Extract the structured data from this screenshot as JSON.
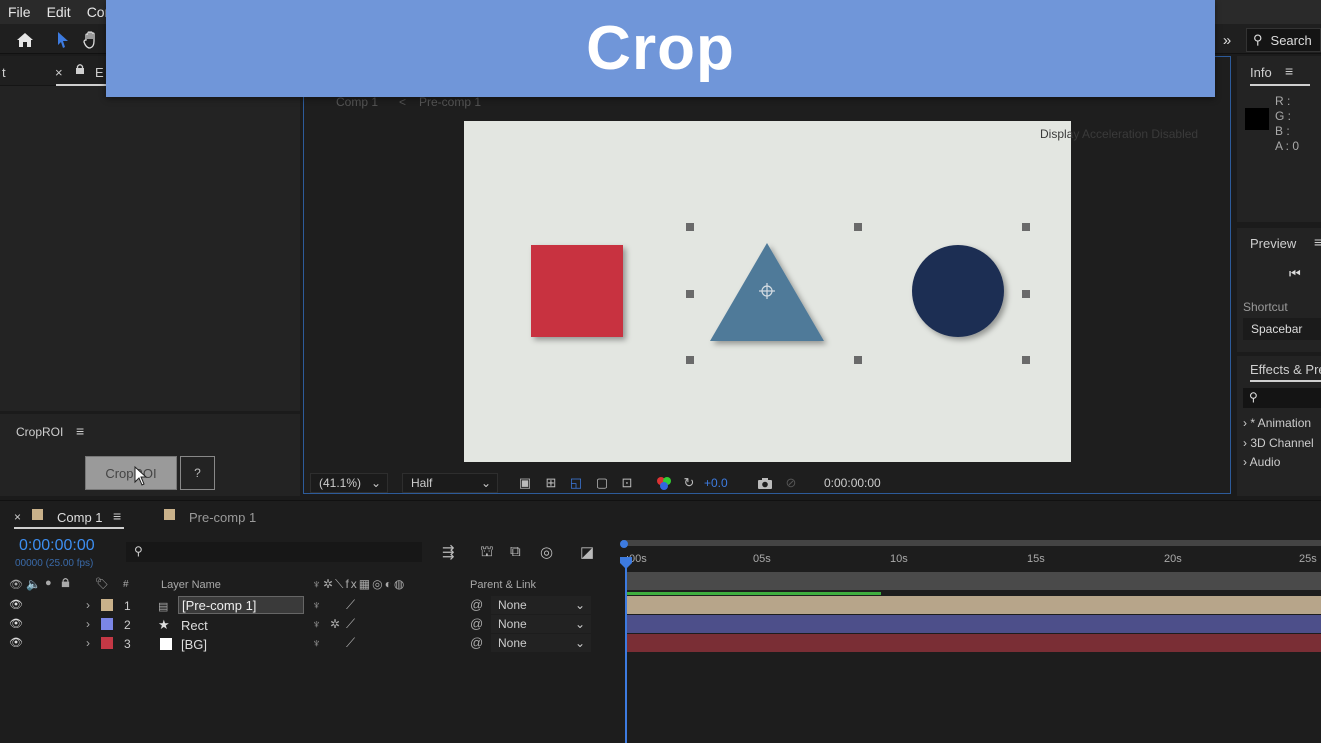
{
  "menubar": {
    "items": [
      "File",
      "Edit",
      "Cor"
    ]
  },
  "banner": {
    "title": "Crop"
  },
  "search": {
    "label": "Search"
  },
  "left_panel": {
    "tab_close": "×",
    "tab_label": "E",
    "tab_prefix": "t"
  },
  "croproi": {
    "title": "CropROI",
    "button_label": "CropROI",
    "help_label": "?"
  },
  "viewer": {
    "breadcrumb": [
      "Comp 1",
      "Pre-comp 1"
    ],
    "display_note": "Display Acceleration Disabled",
    "zoom": "(41.1%)",
    "resolution": "Half",
    "exposure": "+0.0",
    "timecode": "0:00:00:00"
  },
  "info_panel": {
    "title": "Info",
    "channels": [
      "R :",
      "G :",
      "B :",
      "A : 0"
    ]
  },
  "preview_panel": {
    "title": "Preview",
    "shortcut_label": "Shortcut",
    "shortcut_value": "Spacebar"
  },
  "effects_panel": {
    "title": "Effects & Pre",
    "items": [
      "* Animation",
      "3D Channel",
      "Audio"
    ]
  },
  "timeline": {
    "tabs": [
      {
        "label": "Comp 1",
        "color": "#c9b18a"
      },
      {
        "label": "Pre-comp 1",
        "color": "#c9b18a"
      }
    ],
    "timecode": "0:00:00:00",
    "frame_info": "00000 (25.00 fps)",
    "col_layer_name": "Layer Name",
    "col_parent": "Parent & Link",
    "col_hash": "#",
    "ruler_labels": [
      ":00s",
      "05s",
      "10s",
      "15s",
      "20s",
      "25s"
    ],
    "layers": [
      {
        "num": "1",
        "name": "[Pre-comp 1]",
        "label_color": "#c9b18a",
        "parent": "None",
        "track_color": "#b7a58a"
      },
      {
        "num": "2",
        "name": "Rect",
        "label_color": "#7b86e6",
        "parent": "None",
        "track_color": "#4d4f8a"
      },
      {
        "num": "3",
        "name": "[BG]",
        "label_color": "#c43845",
        "parent": "None",
        "track_color": "#7a2e35"
      }
    ]
  },
  "colors": {
    "square": "#c8303f",
    "triangle": "#4f7a99",
    "circle": "#1e2f52",
    "accent": "#2e74d6"
  }
}
